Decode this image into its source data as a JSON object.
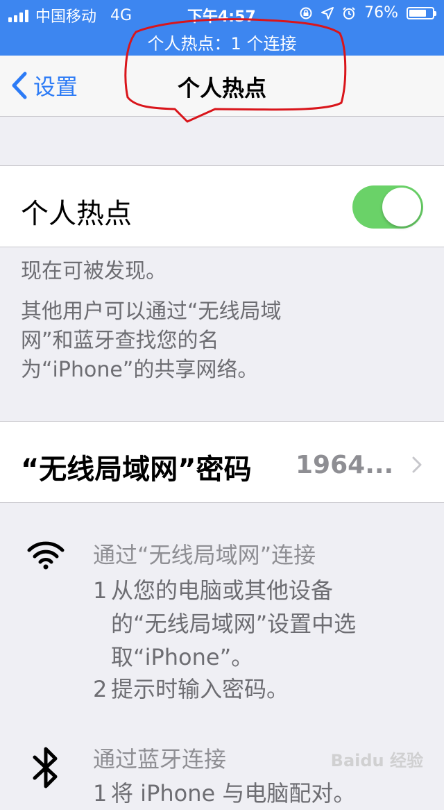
{
  "status_bar": {
    "carrier": "中国移动",
    "network": "4G",
    "time": "下午4:57",
    "battery": "76%",
    "battery_level": 0.76
  },
  "hotspot_banner": "个人热点：1 个连接",
  "nav": {
    "back_label": "设置",
    "title": "个人热点"
  },
  "hotspot_toggle": {
    "label": "个人热点",
    "on": true,
    "color": "#6ad268"
  },
  "info": {
    "discoverable": "现在可被发现。",
    "description": "其他用户可以通过“无线局域\n网”和蓝牙查找您的名\n为“iPhone”的共享网络。"
  },
  "wifi_password": {
    "label": "“无线局域网”密码",
    "value": "1964..."
  },
  "wifi_instructions": {
    "title": "通过“无线局域网”连接",
    "step1_num": "1",
    "step1_text": "从您的电脑或其他设备\n的“无线局域网”设置中选\n取“iPhone”。",
    "step2_num": "2",
    "step2_text": "提示时输入密码。"
  },
  "bluetooth_instructions": {
    "title": "通过蓝牙连接",
    "step1_num": "1",
    "step1_text": "将 iPhone 与电脑配对。"
  },
  "watermark": "Baidu 经验",
  "colors": {
    "accent": "#2c7bf6",
    "status_bar": "#3d86f0",
    "annotation": "#d9151b"
  }
}
